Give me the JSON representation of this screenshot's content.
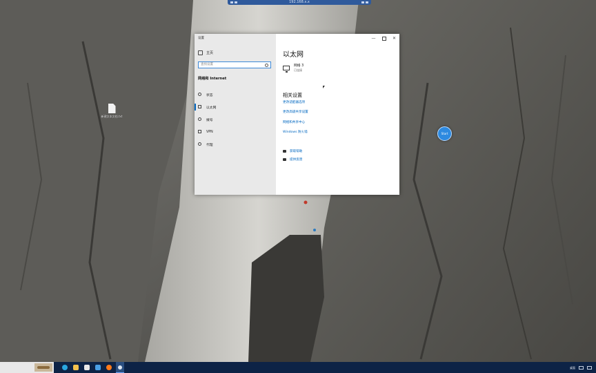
{
  "remote_bar": {
    "title": "192.168.x.x"
  },
  "desktop": {
    "file_icon": {
      "icon": "file-icon",
      "label": "新建文本文档.txt"
    },
    "floating_button": {
      "label": "Start"
    }
  },
  "settings": {
    "window_title": "设置",
    "controls": {
      "minimize": "—",
      "close": "✕"
    },
    "home_label": "主页",
    "search_placeholder": "查找设置",
    "section_title": "网络和 Internet",
    "nav": [
      {
        "label": "状态",
        "icon": "status-icon"
      },
      {
        "label": "以太网",
        "icon": "ethernet-icon",
        "active": true
      },
      {
        "label": "拨号",
        "icon": "dialup-icon"
      },
      {
        "label": "VPN",
        "icon": "vpn-icon"
      },
      {
        "label": "代理",
        "icon": "proxy-icon"
      }
    ],
    "page_title": "以太网",
    "network": {
      "name": "网络 3",
      "status": "已连接"
    },
    "related_title": "相关设置",
    "related_links": [
      "更改适配器选项",
      "更改高级共享设置",
      "网络和共享中心",
      "Windows 防火墙"
    ],
    "help_links": [
      {
        "label": "获取帮助",
        "icon": "help-icon"
      },
      {
        "label": "提供反馈",
        "icon": "feedback-icon"
      }
    ]
  },
  "taskbar": {
    "apps": [
      {
        "name": "edge-icon",
        "color": "#2aa7e0"
      },
      {
        "name": "file-explorer-icon",
        "color": "#f2c14e"
      },
      {
        "name": "store-icon",
        "color": "#e9e9e9"
      },
      {
        "name": "mail-icon",
        "color": "#4aa0e6"
      },
      {
        "name": "firefox-icon",
        "color": "#ff7a1a"
      },
      {
        "name": "settings-icon",
        "color": "#dfe6f0",
        "active": true
      }
    ],
    "tray_text": "桌面",
    "clock_time": "",
    "clock_date": ""
  }
}
